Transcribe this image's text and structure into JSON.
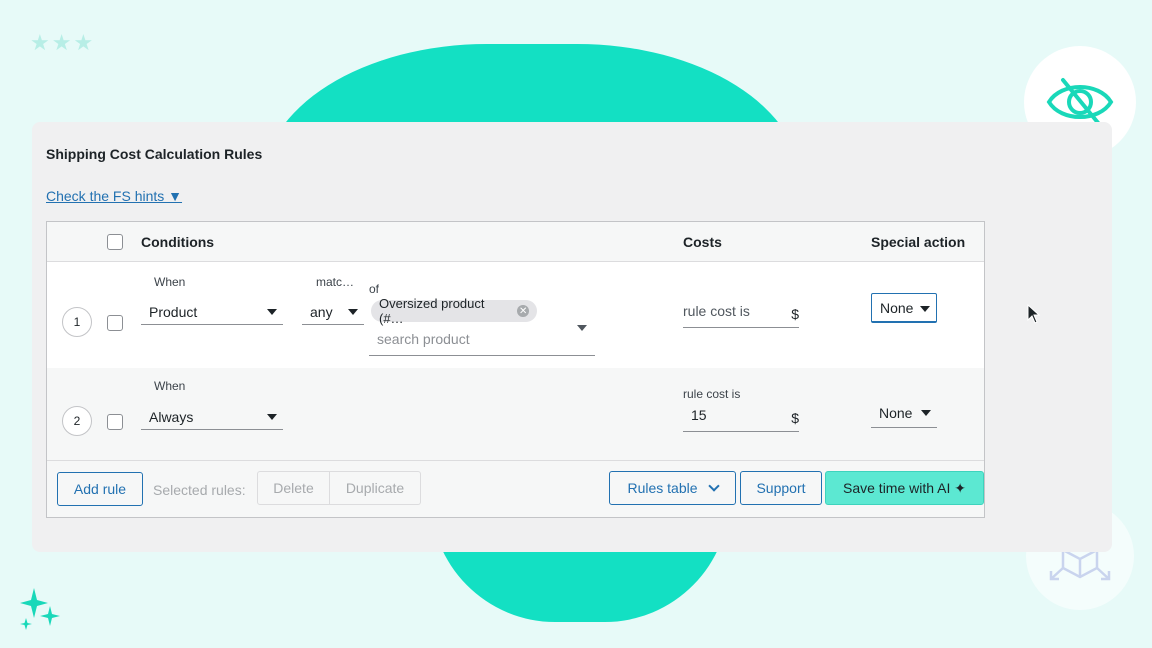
{
  "panel": {
    "title": "Shipping Cost Calculation Rules",
    "hints_link": "Check the FS hints ▼"
  },
  "table": {
    "headers": {
      "conditions": "Conditions",
      "costs": "Costs",
      "special_action": "Special action"
    },
    "rows": [
      {
        "number": "1",
        "when_label": "When",
        "when_value": "Product",
        "match_label": "matc…",
        "match_value": "any",
        "of_label": "of",
        "chip": "Oversized product (#…",
        "search_placeholder": "search product",
        "cost_label": "rule cost is",
        "currency": "$",
        "special": "None"
      },
      {
        "number": "2",
        "when_label": "When",
        "when_value": "Always",
        "cost_label": "rule cost is",
        "cost_value": "15",
        "currency": "$",
        "special": "None"
      }
    ]
  },
  "footer": {
    "add_rule": "Add rule",
    "selected_rules": "Selected rules:",
    "delete": "Delete",
    "duplicate": "Duplicate",
    "rules_table": "Rules table",
    "support": "Support",
    "ai": "Save time with AI ✦"
  },
  "colors": {
    "accent": "#13e0c3",
    "link": "#2271b1",
    "ai_button": "#5ce8d2"
  }
}
